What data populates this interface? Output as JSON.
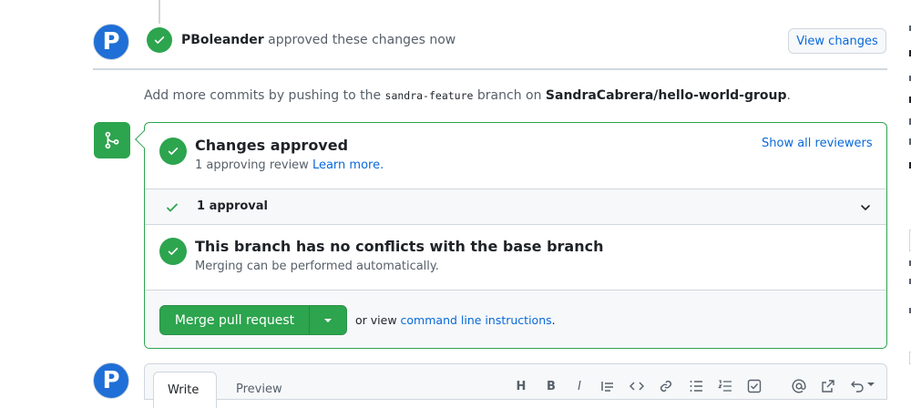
{
  "timeline": {
    "reviewer": "PBoleander",
    "review_text": "approved these changes now",
    "view_changes_label": "View changes"
  },
  "push_hint": {
    "prefix": "Add more commits by pushing to the",
    "branch": "sandra-feature",
    "middle": "branch on",
    "repo": "SandraCabrera/hello-world-group",
    "suffix": "."
  },
  "merge_box": {
    "approved_title": "Changes approved",
    "approved_sub": "1 approving review",
    "learn_more": "Learn more.",
    "show_reviewers": "Show all reviewers",
    "approval_count": "1 approval",
    "conflicts_title": "This branch has no conflicts with the base branch",
    "conflicts_sub": "Merging can be performed automatically.",
    "merge_button": "Merge pull request",
    "or_view": "or view",
    "cli_link": "command line instructions",
    "cli_suffix": "."
  },
  "composer": {
    "tab_write": "Write",
    "tab_preview": "Preview",
    "tools": [
      "H",
      "B",
      "I"
    ]
  },
  "colors": {
    "success": "#2da44e",
    "link": "#0969da",
    "avatar": "#1f6fd6"
  },
  "icons": [
    "check-icon",
    "git-merge-icon",
    "chevron-down-icon",
    "caret-down-icon",
    "quote-icon",
    "code-icon",
    "link-icon",
    "list-icon",
    "task-list-icon",
    "mention-icon",
    "reference-icon",
    "undo-icon"
  ]
}
